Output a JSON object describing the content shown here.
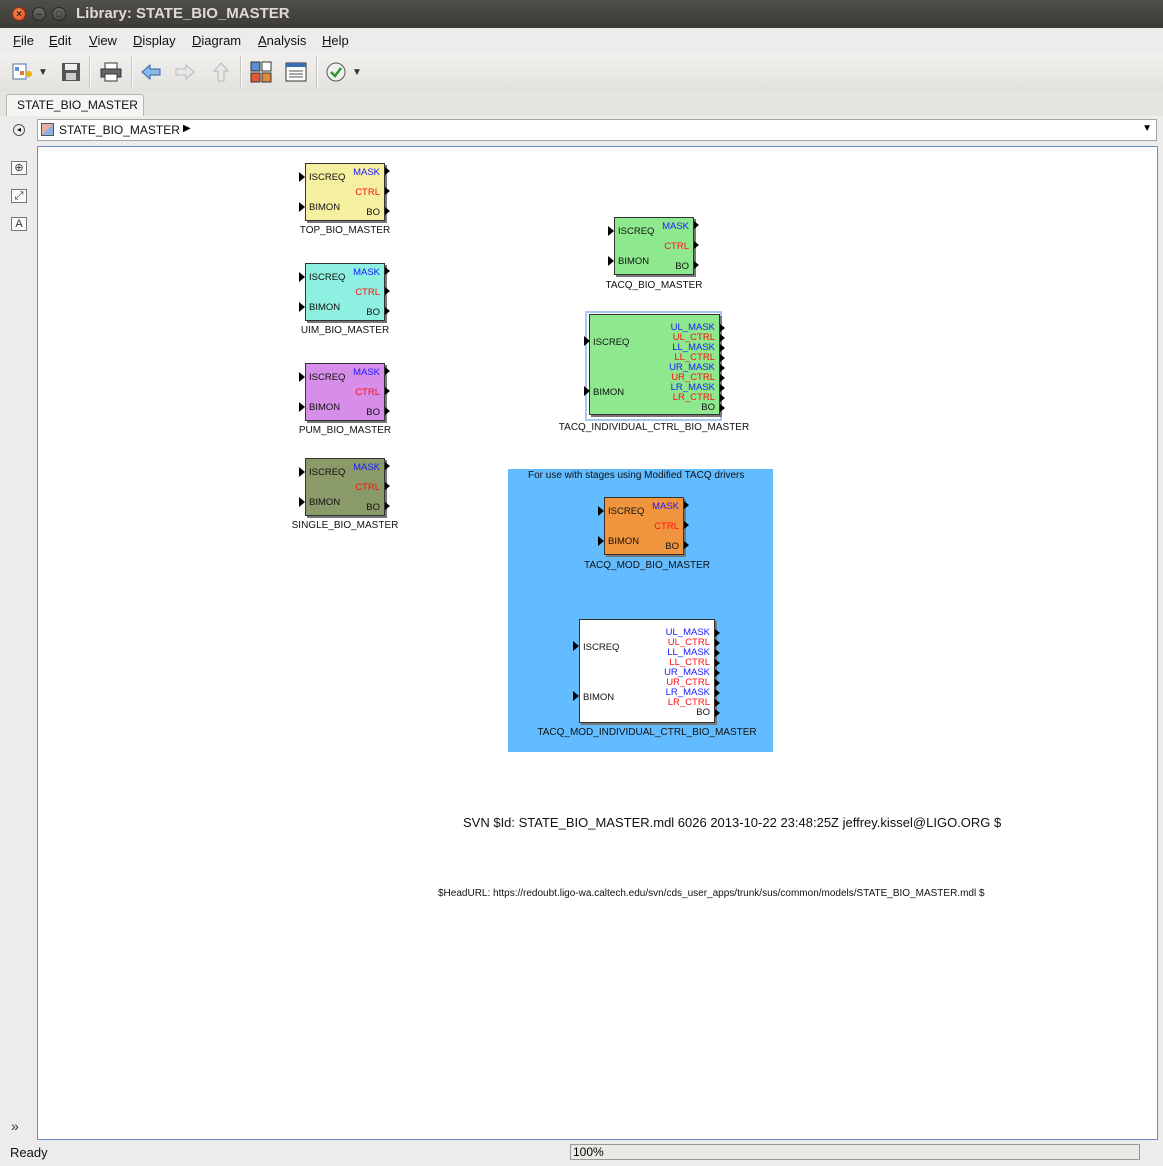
{
  "window": {
    "title": "Library: STATE_BIO_MASTER",
    "close": "×",
    "minimize": "–",
    "maximize": "□"
  },
  "menu": [
    "File",
    "Edit",
    "View",
    "Display",
    "Diagram",
    "Analysis",
    "Help"
  ],
  "toolbar": {
    "icons": [
      "new-model-icon",
      "dropdown-arrow-icon",
      "save-icon",
      "print-icon",
      "back-arrow-icon",
      "forward-arrow-icon",
      "up-arrow-icon",
      "library-browser-icon",
      "model-explorer-icon",
      "check-icon",
      "dropdown-arrow-icon"
    ]
  },
  "tab": {
    "label": "STATE_BIO_MASTER"
  },
  "address": {
    "path": "STATE_BIO_MASTER"
  },
  "blocks": {
    "top": {
      "name": "TOP_BIO_MASTER",
      "in1": "ISCREQ",
      "in2": "BIMON",
      "out1": "MASK",
      "out2": "CTRL",
      "out3": "BO",
      "color": "#f4f0a0"
    },
    "uim": {
      "name": "UIM_BIO_MASTER",
      "in1": "ISCREQ",
      "in2": "BIMON",
      "out1": "MASK",
      "out2": "CTRL",
      "out3": "BO",
      "color": "#8ef0e0"
    },
    "pum": {
      "name": "PUM_BIO_MASTER",
      "in1": "ISCREQ",
      "in2": "BIMON",
      "out1": "MASK",
      "out2": "CTRL",
      "out3": "BO",
      "color": "#d68ee8"
    },
    "single": {
      "name": "SINGLE_BIO_MASTER",
      "in1": "ISCREQ",
      "in2": "BIMON",
      "out1": "MASK",
      "out2": "CTRL",
      "out3": "BO",
      "color": "#8a9a68"
    },
    "tacq": {
      "name": "TACQ_BIO_MASTER",
      "in1": "ISCREQ",
      "in2": "BIMON",
      "out1": "MASK",
      "out2": "CTRL",
      "out3": "BO",
      "color": "#8ee88e"
    },
    "tacq_ind": {
      "name": "TACQ_INDIVIDUAL_CTRL_BIO_MASTER",
      "in1": "ISCREQ",
      "in2": "BIMON",
      "outs": [
        "UL_MASK",
        "UL_CTRL",
        "LL_MASK",
        "LL_CTRL",
        "UR_MASK",
        "UR_CTRL",
        "LR_MASK",
        "LR_CTRL",
        "BO"
      ],
      "color": "#8ee88e"
    },
    "tacq_mod": {
      "name": "TACQ_MOD_BIO_MASTER",
      "in1": "ISCREQ",
      "in2": "BIMON",
      "out1": "MASK",
      "out2": "CTRL",
      "out3": "BO",
      "color": "#f0943e"
    },
    "tacq_mod_ind": {
      "name": "TACQ_MOD_INDIVIDUAL_CTRL_BIO_MASTER",
      "in1": "ISCREQ",
      "in2": "BIMON",
      "outs": [
        "UL_MASK",
        "UL_CTRL",
        "LL_MASK",
        "LL_CTRL",
        "UR_MASK",
        "UR_CTRL",
        "LR_MASK",
        "LR_CTRL",
        "BO"
      ],
      "color": "#ffffff"
    }
  },
  "area": {
    "label": "For use with stages using Modified TACQ drivers",
    "color": "#62bcff"
  },
  "annotations": {
    "svn": "SVN $Id: STATE_BIO_MASTER.mdl 6026 2013-10-22 23:48:25Z jeffrey.kissel@LIGO.ORG $",
    "headurl": "$HeadURL: https://redoubt.ligo-wa.caltech.edu/svn/cds_user_apps/trunk/sus/common/models/STATE_BIO_MASTER.mdl $"
  },
  "status": {
    "text": "Ready",
    "zoom": "100%"
  }
}
